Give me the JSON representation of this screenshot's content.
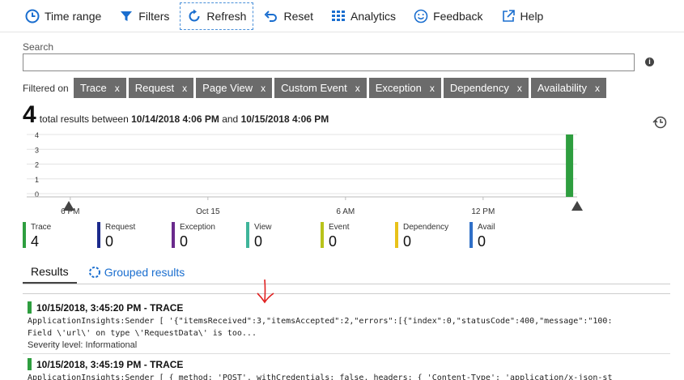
{
  "toolbar": {
    "time_range": "Time range",
    "filters": "Filters",
    "refresh": "Refresh",
    "reset": "Reset",
    "analytics": "Analytics",
    "feedback": "Feedback",
    "help": "Help"
  },
  "search": {
    "label": "Search",
    "value": "",
    "placeholder": ""
  },
  "filters": {
    "label": "Filtered on",
    "chips": [
      "Trace",
      "Request",
      "Page View",
      "Custom Event",
      "Exception",
      "Dependency",
      "Availability"
    ],
    "remove_glyph": "x"
  },
  "summary": {
    "count": "4",
    "prefix": "total results between",
    "start": "10/14/2018 4:06 PM",
    "and": "and",
    "end": "10/15/2018 4:06 PM"
  },
  "chart_data": {
    "type": "bar",
    "title": "",
    "xlabel": "",
    "ylabel": "",
    "ylim": [
      0,
      4
    ],
    "y_ticks": [
      0,
      1,
      2,
      3,
      4
    ],
    "x_ticks": [
      "6 PM",
      "Oct 15",
      "6 AM",
      "12 PM"
    ],
    "x_range": [
      "10/14/2018 4:06 PM",
      "10/15/2018 4:06 PM"
    ],
    "series": [
      {
        "name": "Trace",
        "color": "#2e9e3f",
        "points": [
          {
            "x": "10/15/2018 3:45 PM",
            "y": 4
          }
        ]
      }
    ],
    "grid": true,
    "legend": "bottom"
  },
  "legend": [
    {
      "name": "Trace",
      "value": "4",
      "color": "#2e9e3f"
    },
    {
      "name": "Request",
      "value": "0",
      "color": "#1c2a8c"
    },
    {
      "name": "Exception",
      "value": "0",
      "color": "#6a2a8c"
    },
    {
      "name": "View",
      "value": "0",
      "color": "#3fb59a"
    },
    {
      "name": "Event",
      "value": "0",
      "color": "#b8c31a"
    },
    {
      "name": "Dependency",
      "value": "0",
      "color": "#e8c21a"
    },
    {
      "name": "Avail",
      "value": "0",
      "color": "#2f6fc7"
    }
  ],
  "tabs": {
    "results": "Results",
    "grouped": "Grouped results"
  },
  "results": [
    {
      "timestamp": "10/15/2018, 3:45:20 PM - TRACE",
      "line1": "ApplicationInsights:Sender [ '{\"itemsReceived\":3,\"itemsAccepted\":2,\"errors\":[{\"index\":0,\"statusCode\":400,\"message\":\"100:",
      "line2": "Field \\'url\\' on type \\'RequestData\\' is too...",
      "severity_label": "Severity level:",
      "severity_value": "Informational"
    },
    {
      "timestamp": "10/15/2018, 3:45:19 PM - TRACE",
      "line1": "ApplicationInsights:Sender [ { method: 'POST', withCredentials: false, headers: { 'Content-Type': 'application/x-json-st"
    }
  ],
  "colors": {
    "accent": "#1a6ecf",
    "chip_bg": "#6b6b6b",
    "trace": "#2e9e3f",
    "annotation_arrow": "#e02020"
  }
}
